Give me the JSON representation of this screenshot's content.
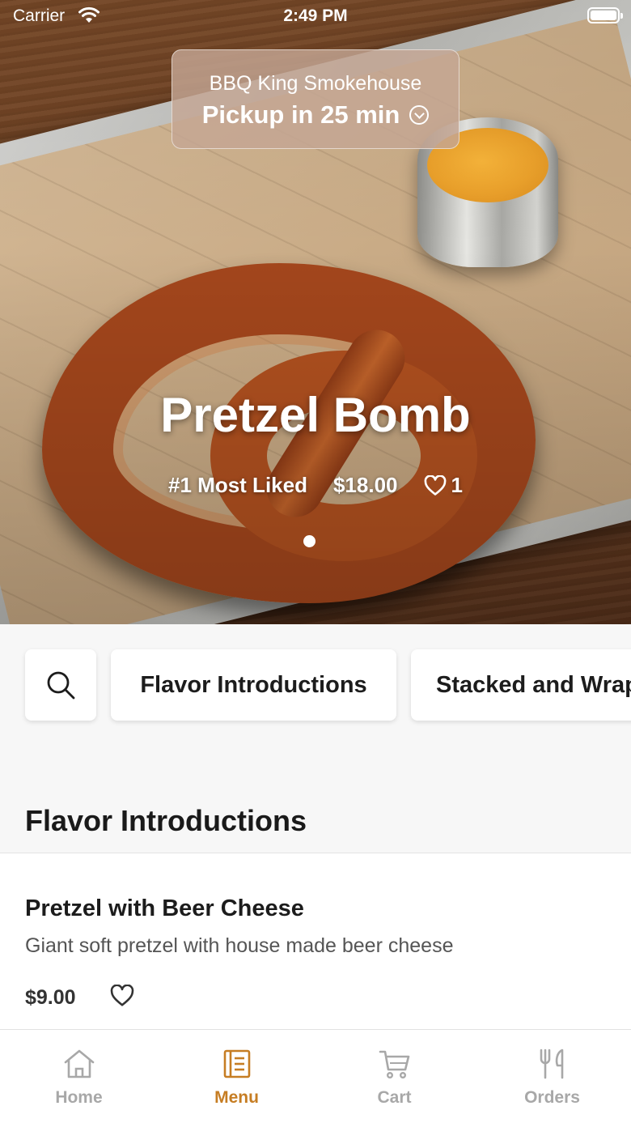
{
  "status_bar": {
    "carrier": "Carrier",
    "time": "2:49 PM"
  },
  "pickup": {
    "store_name": "BBQ King Smokehouse",
    "pickup_time": "Pickup in 25 min"
  },
  "featured": {
    "title": "Pretzel Bomb",
    "badge": "#1 Most Liked",
    "price": "$18.00",
    "likes": "1"
  },
  "categories": [
    {
      "label": "Flavor Introductions"
    },
    {
      "label": "Stacked and Wrapped"
    }
  ],
  "section": {
    "title": "Flavor Introductions"
  },
  "menu_items": [
    {
      "name": "Pretzel with Beer Cheese",
      "description": "Giant soft pretzel with house made beer cheese",
      "price": "$9.00"
    }
  ],
  "tabs": [
    {
      "label": "Home",
      "icon": "home-icon"
    },
    {
      "label": "Menu",
      "icon": "menu-book-icon"
    },
    {
      "label": "Cart",
      "icon": "cart-icon"
    },
    {
      "label": "Orders",
      "icon": "utensils-icon"
    }
  ],
  "colors": {
    "accent": "#c67d23",
    "tab_inactive": "#a8a8a8",
    "background": "#f7f7f7"
  }
}
